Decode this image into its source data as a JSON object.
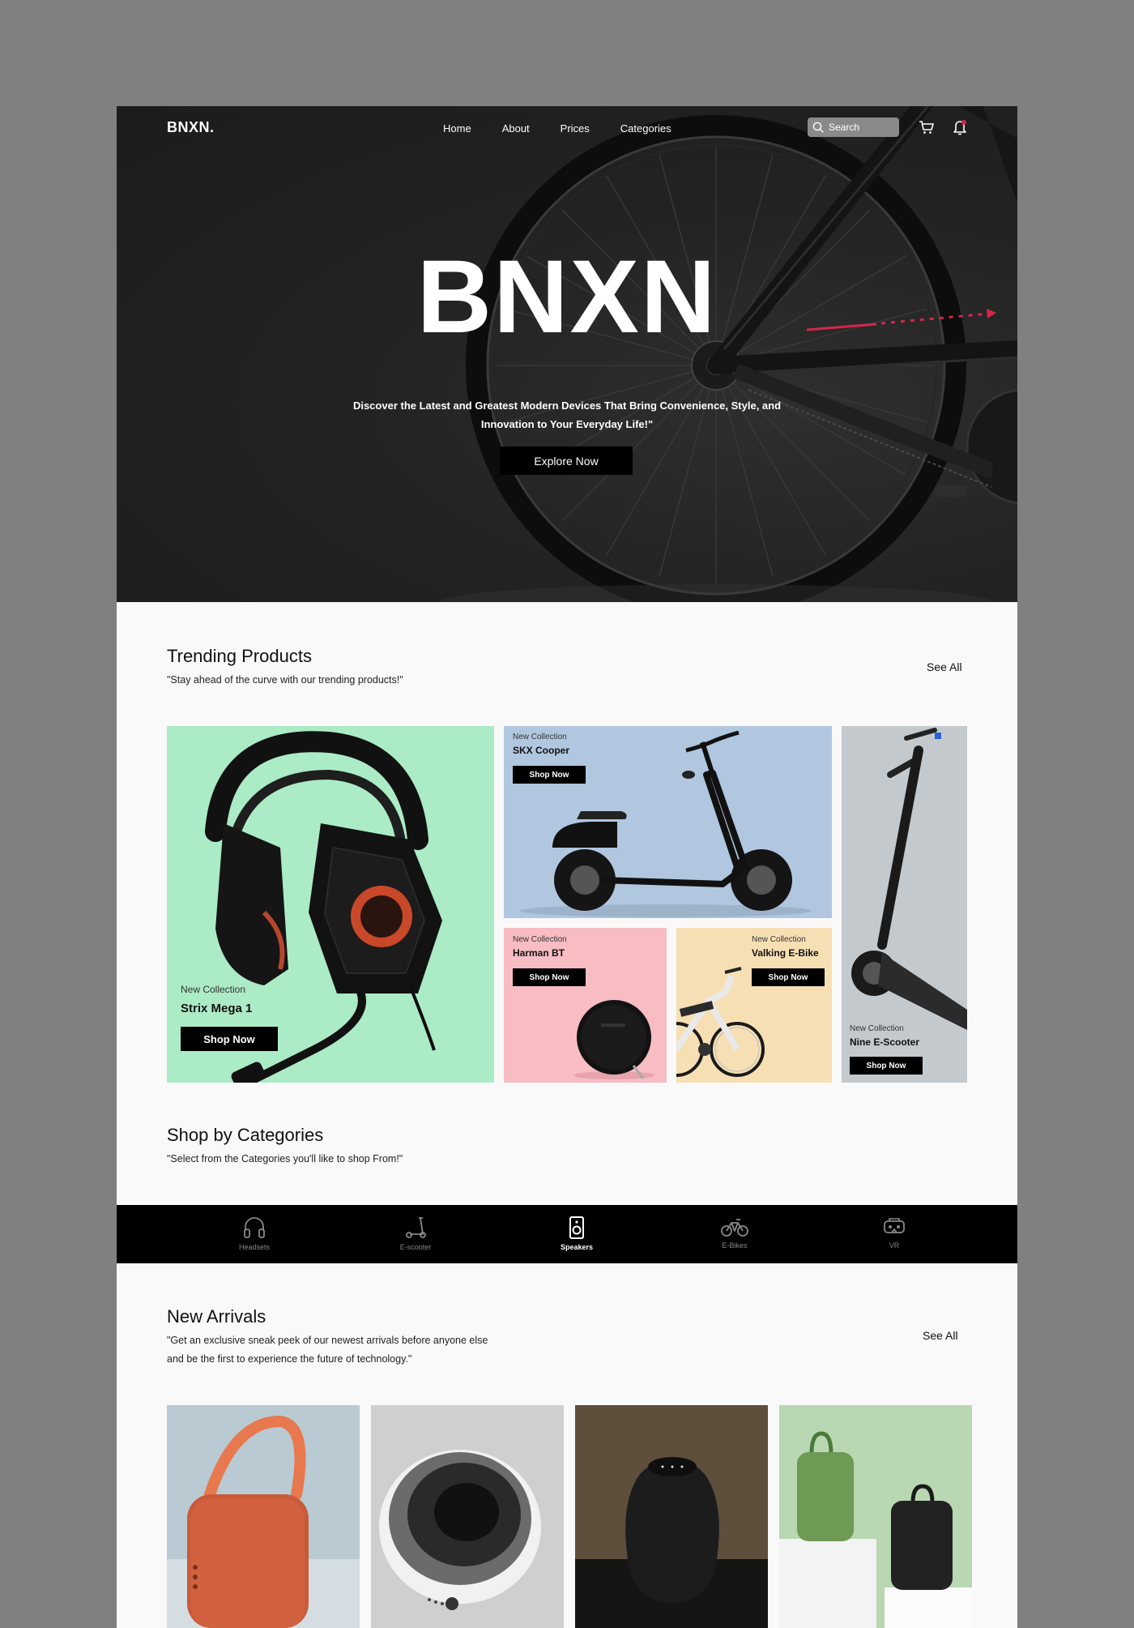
{
  "nav": {
    "logo": "BNXN.",
    "links": [
      "Home",
      "About",
      "Prices",
      "Categories"
    ],
    "search_placeholder": "Search"
  },
  "hero": {
    "title": "BNXN",
    "subtitle_line1": "Discover the Latest and Greatest Modern Devices That Bring Convenience, Style, and",
    "subtitle_line2": "Innovation to Your Everyday Life!\"",
    "cta": "Explore Now"
  },
  "trending": {
    "title": "Trending Products",
    "subtitle": "\"Stay ahead of the curve with our trending products!\"",
    "see_all": "See All",
    "cards": [
      {
        "tag": "New Collection",
        "name": "Strix Mega 1",
        "cta": "Shop Now",
        "bg": "#abebc6"
      },
      {
        "tag": "New Collection",
        "name": "SKX Cooper",
        "cta": "Shop Now",
        "bg": "#b0c7df"
      },
      {
        "tag": "New Collection",
        "name": "Harman BT",
        "cta": "Shop Now",
        "bg": "#f8bcc3"
      },
      {
        "tag": "New Collection",
        "name": "Valking E-Bike",
        "cta": "Shop Now",
        "bg": "#f7dfb4"
      },
      {
        "tag": "New Collection",
        "name": "Nine E-Scooter",
        "cta": "Shop Now",
        "bg": "#c4c9cd"
      }
    ]
  },
  "categories": {
    "title": "Shop by Categories",
    "subtitle": "\"Select from the Categories you'll like to shop From!\"",
    "items": [
      {
        "label": "Headsets",
        "icon": "headset-icon"
      },
      {
        "label": "E-scooter",
        "icon": "scooter-icon"
      },
      {
        "label": "Speakers",
        "icon": "speaker-icon",
        "active": true
      },
      {
        "label": "E-Bikes",
        "icon": "bike-icon"
      },
      {
        "label": "VR",
        "icon": "vr-icon"
      }
    ]
  },
  "arrivals": {
    "title": "New Arrivals",
    "subtitle_line1": "\"Get an exclusive sneak peek of our newest arrivals before anyone else",
    "subtitle_line2": "and be the first to experience the future of technology.\"",
    "see_all": "See All"
  },
  "colors": {
    "frame": "#808080",
    "hero_bg": "#232323",
    "accent": "#d4264a",
    "button": "#000000"
  }
}
